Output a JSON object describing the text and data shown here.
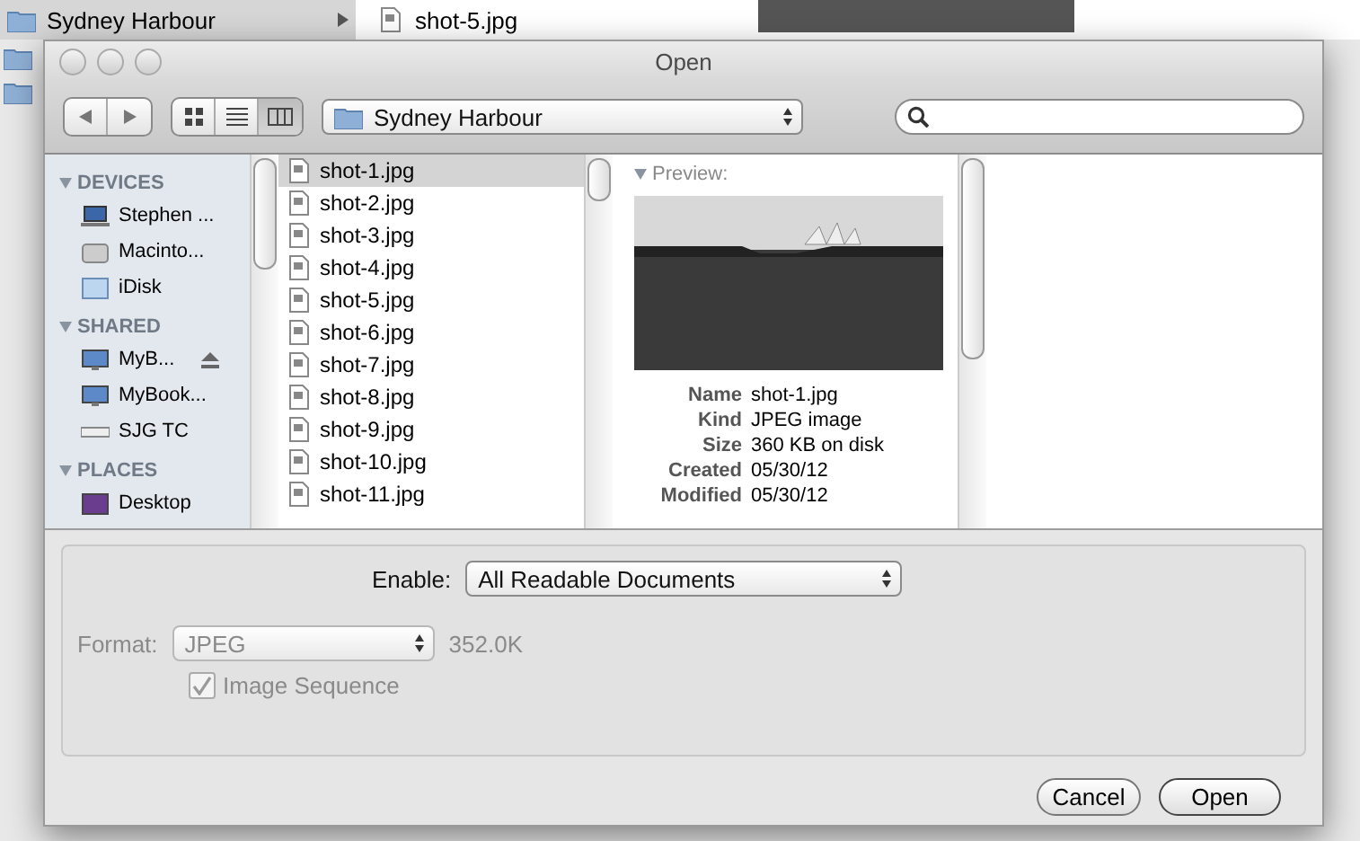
{
  "background": {
    "folder_row": "Sydney Harbour",
    "file": "shot-5.jpg"
  },
  "dialog": {
    "title": "Open",
    "location": "Sydney Harbour",
    "view_modes": [
      {
        "kind": "icons",
        "selected": false
      },
      {
        "kind": "list",
        "selected": false
      },
      {
        "kind": "columns",
        "selected": true
      }
    ],
    "sidebar": [
      {
        "heading": "DEVICES",
        "items": [
          {
            "kind": "laptop",
            "label": "Stephen ...",
            "eject": false
          },
          {
            "kind": "disk",
            "label": "Macinto...",
            "eject": false
          },
          {
            "kind": "cloud",
            "label": "iDisk",
            "eject": false
          }
        ]
      },
      {
        "heading": "SHARED",
        "items": [
          {
            "kind": "monitor",
            "label": "MyB...",
            "eject": true
          },
          {
            "kind": "monitor",
            "label": "MyBook...",
            "eject": false
          },
          {
            "kind": "device",
            "label": "SJG TC",
            "eject": false
          }
        ]
      },
      {
        "heading": "PLACES",
        "items": [
          {
            "kind": "desktop",
            "label": "Desktop",
            "eject": false
          }
        ]
      }
    ],
    "files": [
      {
        "name": "shot-1.jpg",
        "selected": true
      },
      {
        "name": "shot-2.jpg",
        "selected": false
      },
      {
        "name": "shot-3.jpg",
        "selected": false
      },
      {
        "name": "shot-4.jpg",
        "selected": false
      },
      {
        "name": "shot-5.jpg",
        "selected": false
      },
      {
        "name": "shot-6.jpg",
        "selected": false
      },
      {
        "name": "shot-7.jpg",
        "selected": false
      },
      {
        "name": "shot-8.jpg",
        "selected": false
      },
      {
        "name": "shot-9.jpg",
        "selected": false
      },
      {
        "name": "shot-10.jpg",
        "selected": false
      },
      {
        "name": "shot-11.jpg",
        "selected": false
      }
    ],
    "preview": {
      "label": "Preview:",
      "info": [
        {
          "key": "Name",
          "value": "shot-1.jpg"
        },
        {
          "key": "Kind",
          "value": "JPEG image"
        },
        {
          "key": "Size",
          "value": "360 KB on disk"
        },
        {
          "key": "Created",
          "value": "05/30/12"
        },
        {
          "key": "Modified",
          "value": "05/30/12"
        }
      ]
    },
    "enable": {
      "label": "Enable:",
      "value": "All Readable Documents"
    },
    "format": {
      "label": "Format:",
      "value": "JPEG",
      "size": "352.0K",
      "disabled": true
    },
    "image_sequence": {
      "label": "Image Sequence",
      "checked": true,
      "disabled": true
    },
    "buttons": [
      {
        "label": "Cancel",
        "default": false
      },
      {
        "label": "Open",
        "default": true
      }
    ]
  }
}
